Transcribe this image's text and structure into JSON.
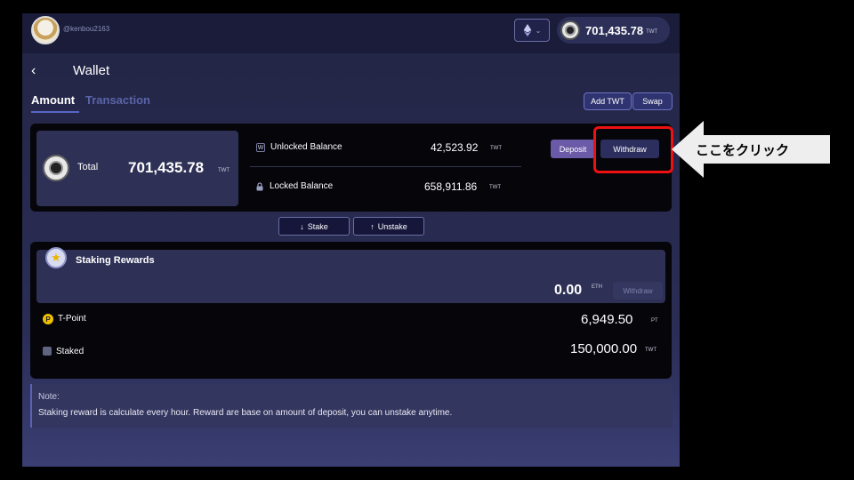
{
  "header": {
    "username": "@kenbou2163",
    "balance_amount": "701,435.78",
    "balance_unit": "TWT",
    "network_icon": "ethereum-icon"
  },
  "page": {
    "title": "Wallet",
    "back_icon": "back-chevron-icon"
  },
  "tabs": [
    {
      "label": "Amount",
      "active": true
    },
    {
      "label": "Transaction",
      "active": false
    }
  ],
  "actions": {
    "add_twt": "Add TWT",
    "swap": "Swap"
  },
  "summary": {
    "total_label": "Total",
    "total_amount": "701,435.78",
    "total_unit": "TWT",
    "unlocked": {
      "label": "Unlocked Balance",
      "amount": "42,523.92",
      "unit": "TWT",
      "icon": "wallet-icon"
    },
    "locked": {
      "label": "Locked Balance",
      "amount": "658,911.86",
      "unit": "TWT",
      "icon": "lock-icon"
    },
    "deposit_label": "Deposit",
    "withdraw_label": "Withdraw"
  },
  "stake": {
    "stake_label": "Stake",
    "unstake_label": "Unstake"
  },
  "rewards": {
    "title": "Staking Rewards",
    "amount": "0.00",
    "unit": "ETH",
    "withdraw_label": "Withdraw",
    "tpoint": {
      "label": "T-Point",
      "amount": "6,949.50",
      "unit": "PT"
    },
    "staked": {
      "label": "Staked",
      "amount": "150,000.00",
      "unit": "TWT"
    }
  },
  "note": {
    "title": "Note:",
    "text": "Staking reward is calculate every hour. Reward are base on amount of deposit, you can unstake anytime."
  },
  "annotation": {
    "callout_text": "ここをクリック",
    "highlight_color": "#e11111"
  },
  "colors": {
    "accent": "#5866c8",
    "deposit": "#6a5aa8"
  }
}
